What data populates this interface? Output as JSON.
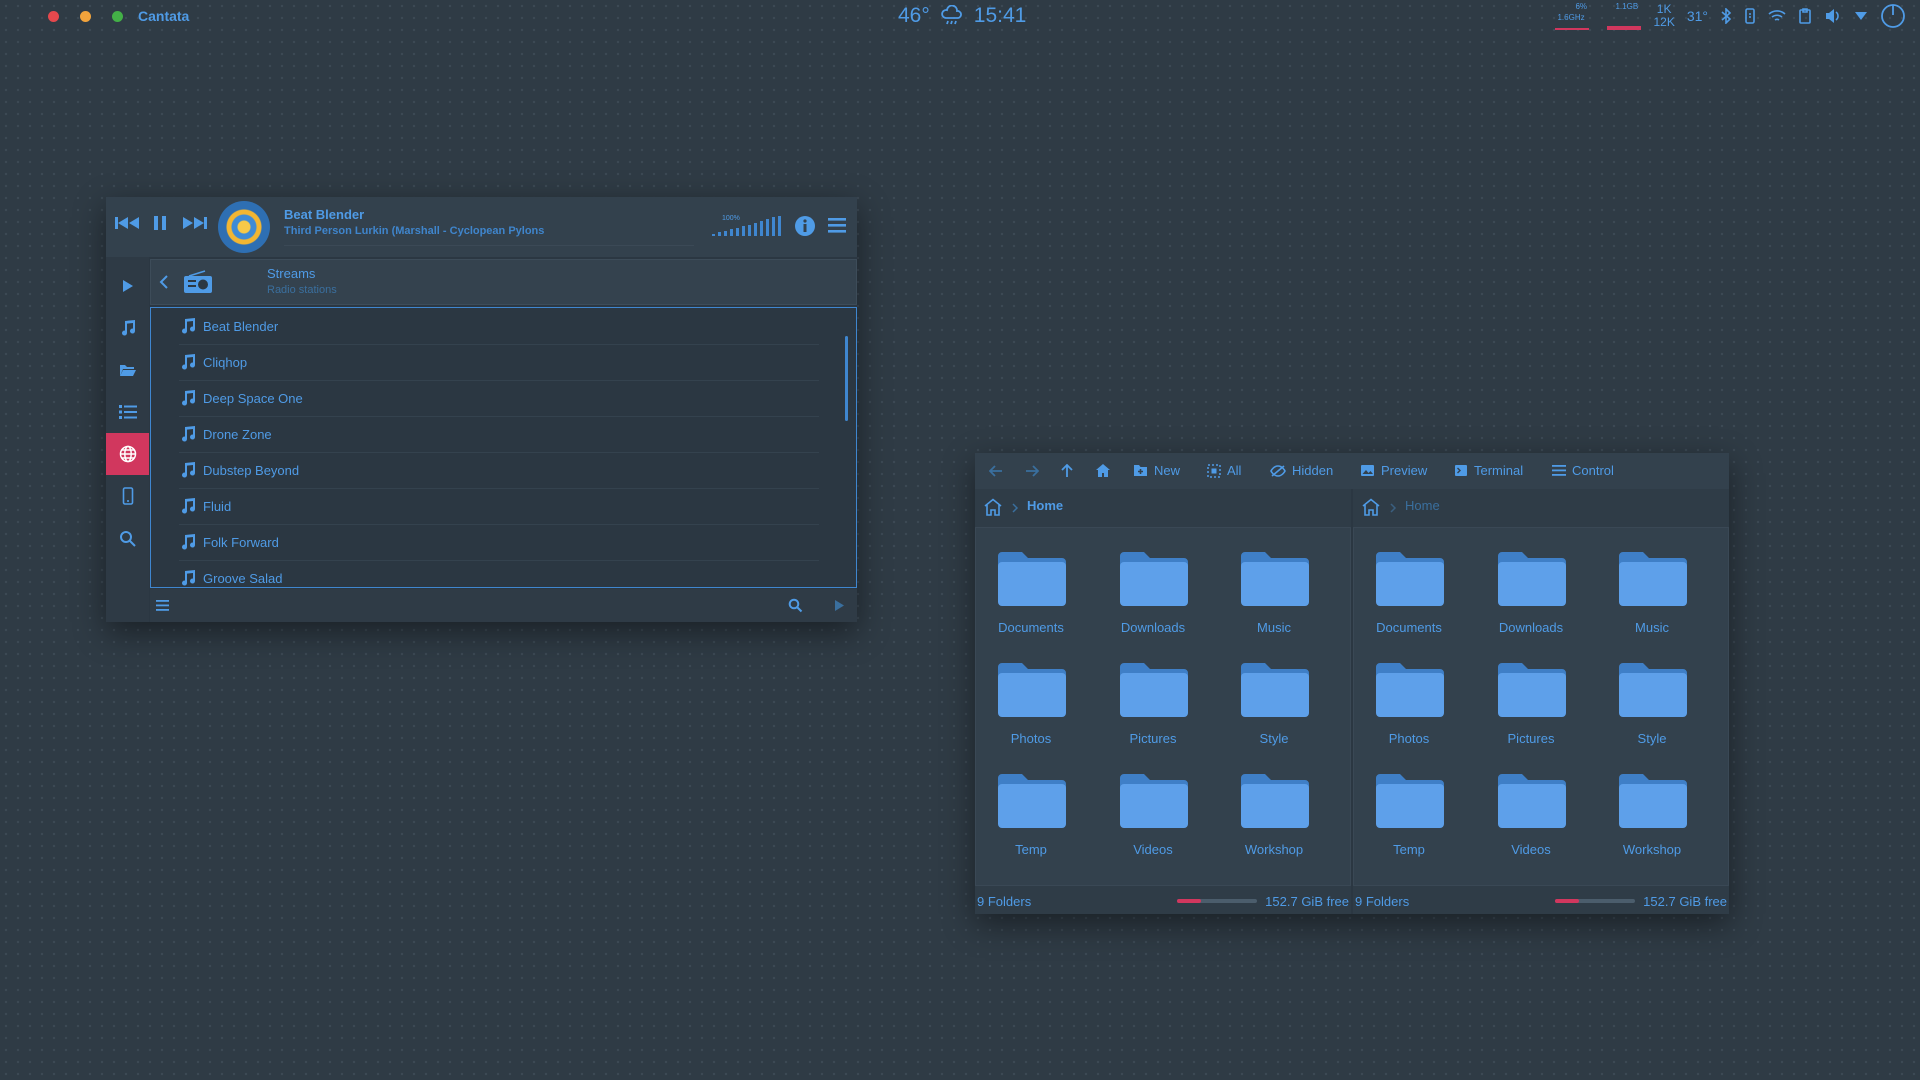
{
  "topbar": {
    "app_name": "Cantata",
    "temperature": "46°",
    "time": "15:41",
    "cpu_top": "6%",
    "cpu_freq": "1.6GHz",
    "mem_top": "1.1GB",
    "net_up": "1K",
    "net_down": "12K",
    "sys_temp": "31°",
    "colors": {
      "close": "#e5484d",
      "minimize": "#f1a33c",
      "maximize": "#43b047"
    }
  },
  "player": {
    "title": "Beat Blender",
    "subtitle": "Third Person Lurkin (Marshall - Cyclopean Pylons",
    "volume": "100%",
    "breadcrumb": {
      "title": "Streams",
      "subtitle": "Radio stations"
    },
    "stations": [
      "Beat Blender",
      "Cliqhop",
      "Deep Space One",
      "Drone Zone",
      "Dubstep Beyond",
      "Fluid",
      "Folk Forward",
      "Groove Salad"
    ],
    "sidebar_icons": [
      "play-icon",
      "music-note-icon",
      "folder-open-icon",
      "list-icon",
      "globe-icon",
      "device-icon",
      "search-icon"
    ],
    "accent": "#d1375e"
  },
  "filemanager": {
    "toolbar": {
      "new": "New",
      "all": "All",
      "hidden": "Hidden",
      "preview": "Preview",
      "terminal": "Terminal",
      "control": "Control"
    },
    "panes": [
      {
        "path": "Home",
        "folders": [
          "Documents",
          "Downloads",
          "Music",
          "Photos",
          "Pictures",
          "Style",
          "Temp",
          "Videos",
          "Workshop"
        ],
        "status": "9 Folders",
        "free": "152.7 GiB free",
        "used_fraction": 0.3
      },
      {
        "path": "Home",
        "folders": [
          "Documents",
          "Downloads",
          "Music",
          "Photos",
          "Pictures",
          "Style",
          "Temp",
          "Videos",
          "Workshop"
        ],
        "status": "9 Folders",
        "free": "152.7 GiB free",
        "used_fraction": 0.3
      }
    ]
  }
}
